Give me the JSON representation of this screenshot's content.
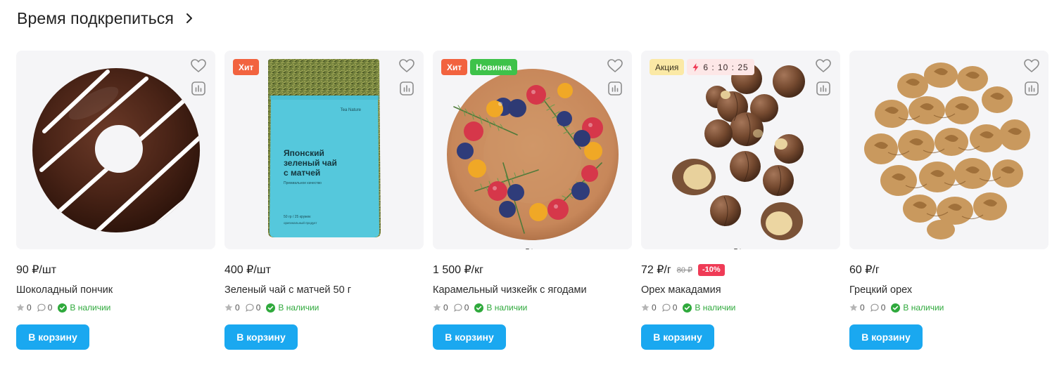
{
  "section": {
    "title": "Время подкрепиться"
  },
  "colors": {
    "accent": "#1aa8f0",
    "hit": "#f2633f",
    "new": "#3ec24a",
    "promo": "#fbe9a6",
    "discount": "#ef3b56",
    "stock": "#2fa93c"
  },
  "cart_label": "В корзину",
  "products": [
    {
      "price": "90 ₽/шт",
      "name": "Шоколадный пончик",
      "rating": "0",
      "reviews": "0",
      "stock": "В наличии",
      "image": "donut"
    },
    {
      "price": "400 ₽/шт",
      "name": "Зеленый чай с матчей 50 г",
      "rating": "0",
      "reviews": "0",
      "stock": "В наличии",
      "image": "tea-pack",
      "badge_hit": "Хит",
      "pack_brand": "Tea Nature",
      "pack_title_1": "Японский",
      "pack_title_2": "зеленый чай",
      "pack_title_3": "с матчей",
      "pack_sub": "Премиальное качество",
      "pack_weight": "50 гр / 25 кружек",
      "pack_note": "оригинальный продукт"
    },
    {
      "price": "1 500 ₽/кг",
      "name": "Карамельный чизкейк с ягодами",
      "rating": "0",
      "reviews": "0",
      "stock": "В наличии",
      "image": "cheesecake",
      "badge_hit": "Хит",
      "badge_new": "Новинка"
    },
    {
      "price": "72 ₽/г",
      "old_price": "80 ₽",
      "discount": "-10%",
      "name": "Орех макадамия",
      "rating": "0",
      "reviews": "0",
      "stock": "В наличии",
      "image": "macadamia",
      "badge_promo": "Акция",
      "timer": "6 : 10 : 25"
    },
    {
      "price": "60 ₽/г",
      "name": "Грецкий орех",
      "rating": "0",
      "reviews": "0",
      "stock": "В наличии",
      "image": "walnuts"
    }
  ]
}
